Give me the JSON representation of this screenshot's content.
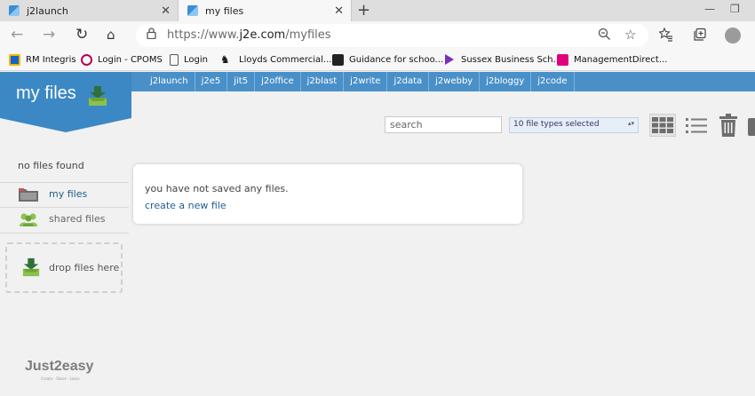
{
  "browser": {
    "tabs": [
      {
        "title": "j2launch"
      },
      {
        "title": "my files",
        "active": true
      }
    ],
    "url_prefix": "https://www.",
    "url_domain": "j2e.com",
    "url_path": "/myfiles",
    "bookmarks": [
      {
        "label": "RM Integris",
        "icon": "rm-integris-icon",
        "color": "#1565c0"
      },
      {
        "label": "Login - CPOMS",
        "icon": "cpoms-icon",
        "color": "#b5005e"
      },
      {
        "label": "Login",
        "icon": "page-icon",
        "color": "#555555"
      },
      {
        "label": "Lloyds Commercial...",
        "icon": "lloyds-horse-icon",
        "color": "#111111"
      },
      {
        "label": "Guidance for schoo...",
        "icon": "guidance-icon",
        "color": "#222222"
      },
      {
        "label": "Sussex Business Sch...",
        "icon": "sussex-icon",
        "color": "#7b2fbe"
      },
      {
        "label": "ManagementDirect...",
        "icon": "management-direct-icon",
        "color": "#e0007a"
      }
    ]
  },
  "app": {
    "title": "my files",
    "accent": "#4a90c8",
    "banner_color": "#3b88c4",
    "nav_links": [
      "j2launch",
      "j2e5",
      "jit5",
      "j2office",
      "j2blast",
      "j2write",
      "j2data",
      "j2webby",
      "j2bloggy",
      "j2code"
    ],
    "sidebar": {
      "status": "no files found",
      "items": [
        {
          "label": "my files",
          "icon": "folder-icon",
          "active": true
        },
        {
          "label": "shared files",
          "icon": "people-icon"
        }
      ],
      "drop_label": "drop files here"
    },
    "toolbar": {
      "search_placeholder": "search",
      "file_types": "10 file types selected"
    },
    "content": {
      "empty_message": "you have not saved any files.",
      "create_link": "create a new file"
    },
    "logo": "Just2easy",
    "logo_tagline": "Create · Share · Learn"
  }
}
